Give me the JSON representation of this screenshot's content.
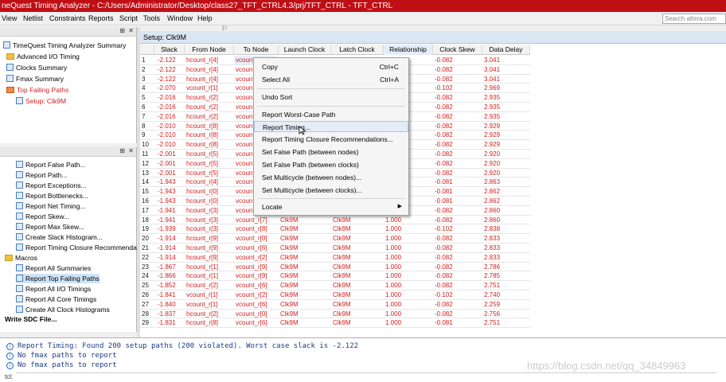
{
  "window": {
    "title": "neQuest Timing Analyzer - C:/Users/Administrator/Desktop/class27_TFT_CTRL4.3/prj/TFT_CTRL - TFT_CTRL",
    "title_bg": "#bf0f15"
  },
  "menubar": {
    "items": [
      "View",
      "Netlist",
      "Constraints",
      "Reports",
      "Script",
      "Tools",
      "Window",
      "Help"
    ],
    "search_placeholder": "Search altera.com"
  },
  "report_tree": {
    "items": [
      {
        "label": "TimeQuest Timing Analyzer Summary",
        "icon": "report-icon"
      },
      {
        "label": "Advanced I/O Timing",
        "icon": "folder-icon"
      },
      {
        "label": "Clocks Summary",
        "icon": "report-icon"
      },
      {
        "label": "Fmax Summary",
        "icon": "report-icon"
      },
      {
        "label": "Top Failing Paths",
        "icon": "folder-icon",
        "color": "red"
      },
      {
        "label": "Setup: Clk9M",
        "icon": "report-icon",
        "color": "red",
        "selected": true
      }
    ]
  },
  "tasks_tree": {
    "items": [
      {
        "label": "Report False Path..."
      },
      {
        "label": "Report Path..."
      },
      {
        "label": "Report Exceptions..."
      },
      {
        "label": "Report Bottlenecks..."
      },
      {
        "label": "Report Net Timing..."
      },
      {
        "label": "Report Skew..."
      },
      {
        "label": "Report Max Skew..."
      },
      {
        "label": "Create Slack Histogram..."
      },
      {
        "label": "Report Timing Closure Recommendat"
      }
    ],
    "macros_label": "Macros",
    "macros": [
      {
        "label": "Report All Summaries"
      },
      {
        "label": "Report Top Failing Paths",
        "selected": true
      },
      {
        "label": "Report All I/O Timings"
      },
      {
        "label": "Report All Core Timings"
      },
      {
        "label": "Create All Clock Histograms"
      }
    ],
    "write_sdc": "Write SDC File..."
  },
  "main": {
    "setup_header": "Setup: Clk9M",
    "columns": [
      "Slack",
      "From Node",
      "To Node",
      "Launch Clock",
      "Latch Clock",
      "Relationship",
      "Clock Skew",
      "Data Delay"
    ],
    "rows": [
      [
        "1",
        "-2.122",
        "hcount_r[4]",
        "vcount_r[9]",
        "Clk9M",
        "Clk9M",
        "1.000",
        "-0.082",
        "3.041"
      ],
      [
        "2",
        "-2.122",
        "hcount_r[4]",
        "vcount_r[8]",
        "Clk9M",
        "Clk9M",
        "1.000",
        "-0.082",
        "3.041"
      ],
      [
        "3",
        "-2.122",
        "hcount_r[4]",
        "vcount_r[7]",
        "Clk9M",
        "Clk9M",
        "1.000",
        "-0.082",
        "3.041"
      ],
      [
        "4",
        "-2.070",
        "vcount_r[1]",
        "vcount_r[9]",
        "Clk9M",
        "Clk9M",
        "1.000",
        "-0.102",
        "2.969"
      ],
      [
        "5",
        "-2.016",
        "hcount_r[2]",
        "vcount_r[9]",
        "Clk9M",
        "Clk9M",
        "1.000",
        "-0.082",
        "2.935"
      ],
      [
        "6",
        "-2.016",
        "hcount_r[2]",
        "vcount_r[8]",
        "Clk9M",
        "Clk9M",
        "1.000",
        "-0.082",
        "2.935"
      ],
      [
        "7",
        "-2.016",
        "hcount_r[2]",
        "vcount_r[7]",
        "Clk9M",
        "Clk9M",
        "1.000",
        "-0.082",
        "2.935"
      ],
      [
        "8",
        "-2.010",
        "hcount_r[8]",
        "vcount_r[9]",
        "Clk9M",
        "Clk9M",
        "1.000",
        "-0.082",
        "2.929"
      ],
      [
        "9",
        "-2.010",
        "hcount_r[8]",
        "vcount_r[8]",
        "Clk9M",
        "Clk9M",
        "1.000",
        "-0.082",
        "2.929"
      ],
      [
        "10",
        "-2.010",
        "hcount_r[8]",
        "vcount_r[7]",
        "Clk9M",
        "Clk9M",
        "1.000",
        "-0.082",
        "2.929"
      ],
      [
        "11",
        "-2.001",
        "hcount_r[5]",
        "vcount_r[9]",
        "Clk9M",
        "Clk9M",
        "1.000",
        "-0.082",
        "2.920"
      ],
      [
        "12",
        "-2.001",
        "hcount_r[5]",
        "vcount_r[8]",
        "Clk9M",
        "Clk9M",
        "1.000",
        "-0.082",
        "2.920"
      ],
      [
        "13",
        "-2.001",
        "hcount_r[5]",
        "vcount_r[7]",
        "Clk9M",
        "Clk9M",
        "1.000",
        "-0.082",
        "2.920"
      ],
      [
        "14",
        "-1.943",
        "hcount_r[4]",
        "vcount_r[9]",
        "Clk9M",
        "Clk9M",
        "1.000",
        "-0.081",
        "2.863"
      ],
      [
        "15",
        "-1.943",
        "hcount_r[0]",
        "vcount_r[9]",
        "Clk9M",
        "Clk9M",
        "1.000",
        "-0.081",
        "2.862"
      ],
      [
        "16",
        "-1.943",
        "hcount_r[0]",
        "vcount_r[8]",
        "Clk9M",
        "Clk9M",
        "1.000",
        "-0.081",
        "2.862"
      ],
      [
        "17",
        "-1.941",
        "hcount_r[3]",
        "vcount_r[9]",
        "Clk9M",
        "Clk9M",
        "1.000",
        "-0.082",
        "2.860"
      ],
      [
        "18",
        "-1.941",
        "hcount_r[3]",
        "vcount_r[7]",
        "Clk9M",
        "Clk9M",
        "1.000",
        "-0.082",
        "2.860"
      ],
      [
        "19",
        "-1.939",
        "hcount_r[3]",
        "vcount_r[8]",
        "Clk9M",
        "Clk9M",
        "1.000",
        "-0.102",
        "2.838"
      ],
      [
        "20",
        "-1.914",
        "hcount_r[9]",
        "vcount_r[0]",
        "Clk9M",
        "Clk9M",
        "1.000",
        "-0.082",
        "2.833"
      ],
      [
        "21",
        "-1.914",
        "hcount_r[9]",
        "vcount_r[6]",
        "Clk9M",
        "Clk9M",
        "1.000",
        "-0.082",
        "2.833"
      ],
      [
        "22",
        "-1.914",
        "hcount_r[9]",
        "vcount_r[2]",
        "Clk9M",
        "Clk9M",
        "1.000",
        "-0.082",
        "2.833"
      ],
      [
        "23",
        "-1.867",
        "hcount_r[1]",
        "vcount_r[9]",
        "Clk9M",
        "Clk9M",
        "1.000",
        "-0.082",
        "2.786"
      ],
      [
        "24",
        "-1.866",
        "hcount_r[1]",
        "vcount_r[9]",
        "Clk9M",
        "Clk9M",
        "1.000",
        "-0.082",
        "2.785"
      ],
      [
        "25",
        "-1.852",
        "hcount_r[2]",
        "vcount_r[6]",
        "Clk9M",
        "Clk9M",
        "1.000",
        "-0.082",
        "2.751"
      ],
      [
        "26",
        "-1.841",
        "vcount_r[1]",
        "vcount_r[2]",
        "Clk9M",
        "Clk9M",
        "1.000",
        "-0.102",
        "2.740"
      ],
      [
        "27",
        "-1.840",
        "vcount_r[1]",
        "vcount_r[6]",
        "Clk9M",
        "Clk9M",
        "1.000",
        "-0.082",
        "2.259"
      ],
      [
        "28",
        "-1.837",
        "hcount_r[2]",
        "vcount_r[0]",
        "Clk9M",
        "Clk9M",
        "1.000",
        "-0.082",
        "2.756"
      ],
      [
        "29",
        "-1.831",
        "hcount_r[8]",
        "vcount_r[6]",
        "Clk9M",
        "Clk9M",
        "1.000",
        "-0.081",
        "2.751"
      ]
    ]
  },
  "context_menu": {
    "items": [
      {
        "label": "Copy",
        "shortcut": "Ctrl+C"
      },
      {
        "label": "Select All",
        "shortcut": "Ctrl+A"
      },
      {
        "label": "Undo Sort",
        "shortcut": ""
      },
      {
        "label": "Report Worst-Case Path",
        "shortcut": ""
      },
      {
        "label": "Report Timing...",
        "shortcut": "",
        "hover": true
      },
      {
        "label": "Report Timing Closure Recommendations...",
        "shortcut": ""
      },
      {
        "label": "Set False Path (between nodes)",
        "shortcut": ""
      },
      {
        "label": "Set False Path (between clocks)",
        "shortcut": ""
      },
      {
        "label": "Set Multicycle (between nodes)...",
        "shortcut": ""
      },
      {
        "label": "Set Multicycle (between clocks)...",
        "shortcut": ""
      },
      {
        "label": "Locate",
        "shortcut": "",
        "submenu": true
      }
    ]
  },
  "console": {
    "lines": [
      "Report Timing: Found 200 setup paths (200 violated).  Worst case slack is -2.122",
      "No fmax paths to report",
      "No fmax paths to report"
    ],
    "prompt": "tcl:"
  },
  "watermark": "https://blog.csdn.net/qq_34849963"
}
